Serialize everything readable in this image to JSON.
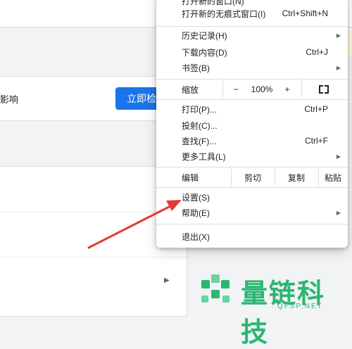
{
  "background": {
    "snippet_text": "影响",
    "check_button_label": "立即检查"
  },
  "menu": {
    "top_partial": {
      "label": "打开新的窗口(N)"
    },
    "incognito": {
      "label": "打开新的无痕式窗口(I)",
      "shortcut": "Ctrl+Shift+N"
    },
    "history": {
      "label": "历史记录(H)"
    },
    "downloads": {
      "label": "下载内容(D)",
      "shortcut": "Ctrl+J"
    },
    "bookmarks": {
      "label": "书签(B)"
    },
    "zoom": {
      "label": "缩放",
      "minus": "−",
      "value": "100%",
      "plus": "+"
    },
    "print": {
      "label": "打印(P)...",
      "shortcut": "Ctrl+P"
    },
    "cast": {
      "label": "投射(C)..."
    },
    "find": {
      "label": "查找(F)...",
      "shortcut": "Ctrl+F"
    },
    "more_tools": {
      "label": "更多工具(L)"
    },
    "edit": {
      "label": "编辑",
      "cut": "剪切",
      "copy": "复制",
      "paste": "粘贴"
    },
    "settings": {
      "label": "设置(S)"
    },
    "help": {
      "label": "帮助(E)"
    },
    "exit": {
      "label": "退出(X)"
    }
  },
  "watermark": {
    "brand": "量链科技",
    "domain": "QFSP.NET"
  },
  "colors": {
    "accent_blue": "#1a73e8",
    "annotation_red": "#e53935",
    "watermark_green": "#2bb673"
  }
}
